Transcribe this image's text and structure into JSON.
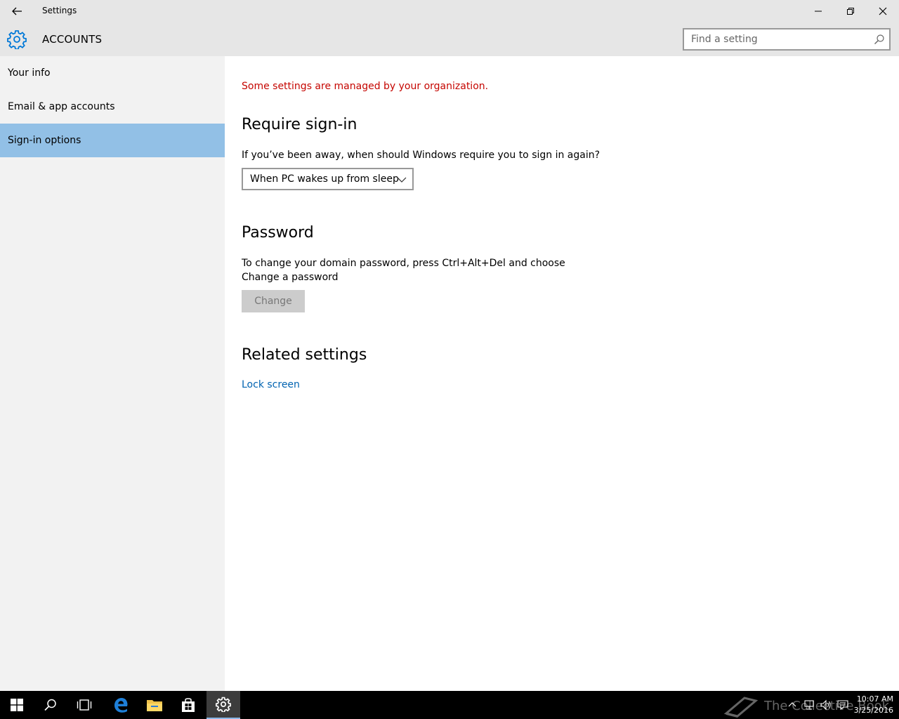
{
  "window": {
    "title": "Settings"
  },
  "header": {
    "section": "ACCOUNTS",
    "search_placeholder": "Find a setting"
  },
  "sidebar": {
    "items": [
      {
        "label": "Your info",
        "selected": false
      },
      {
        "label": "Email & app accounts",
        "selected": false
      },
      {
        "label": "Sign-in options",
        "selected": true
      }
    ]
  },
  "main": {
    "org_notice": "Some settings are managed by your organization.",
    "require_signin": {
      "heading": "Require sign-in",
      "question": "If you’ve been away, when should Windows require you to sign in again?",
      "selected_option": "When PC wakes up from sleep"
    },
    "password": {
      "heading": "Password",
      "line1": "To change your domain password, press Ctrl+Alt+Del and choose",
      "line2": "Change a password",
      "button_label": "Change"
    },
    "related": {
      "heading": "Related settings",
      "link": "Lock screen"
    }
  },
  "taskbar": {
    "watermark": "The Collective Book",
    "time": "10:07 AM",
    "date": "3/25/2016"
  },
  "colors": {
    "accent": "#0078d7",
    "selected_nav": "#92c0e6",
    "warning_text": "#c50500",
    "link": "#0063b1"
  }
}
